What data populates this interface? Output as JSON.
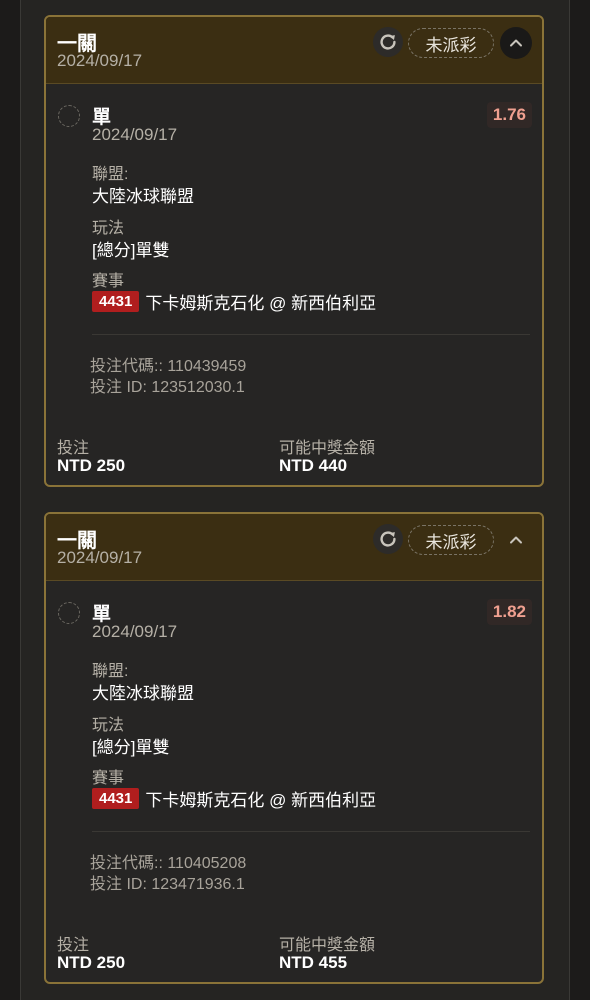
{
  "bets": [
    {
      "header": {
        "title": "一關",
        "date": "2024/09/17",
        "status": "未派彩"
      },
      "bet_type": "單",
      "bet_date": "2024/09/17",
      "odds": "1.76",
      "league_label": "聯盟:",
      "league": "大陸冰球聯盟",
      "play_label": "玩法",
      "play": "[總分]單雙",
      "event_label": "賽事",
      "match_id": "4431",
      "match": "下卡姆斯克石化 @ 新西伯利亞",
      "bet_code": "投注代碼:: 110439459",
      "bet_id": "投注 ID: 123512030.1",
      "stake_label": "投注",
      "stake": "NTD 250",
      "payout_label": "可能中獎金額",
      "payout": "NTD 440"
    },
    {
      "header": {
        "title": "一關",
        "date": "2024/09/17",
        "status": "未派彩"
      },
      "bet_type": "單",
      "bet_date": "2024/09/17",
      "odds": "1.82",
      "league_label": "聯盟:",
      "league": "大陸冰球聯盟",
      "play_label": "玩法",
      "play": "[總分]單雙",
      "event_label": "賽事",
      "match_id": "4431",
      "match": "下卡姆斯克石化 @ 新西伯利亞",
      "bet_code": "投注代碼:: 110405208",
      "bet_id": "投注 ID: 123471936.1",
      "stake_label": "投注",
      "stake": "NTD 250",
      "payout_label": "可能中獎金額",
      "payout": "NTD 455"
    }
  ],
  "icons": {
    "refresh": "refresh-icon",
    "collapse": "chevron-up-icon",
    "select": "radio-circle-icon"
  },
  "colors": {
    "card_border": "#8a7338",
    "header_bg": "#3b2e12",
    "odds_text": "#f0a090",
    "match_id_bg": "#b01e1e"
  }
}
